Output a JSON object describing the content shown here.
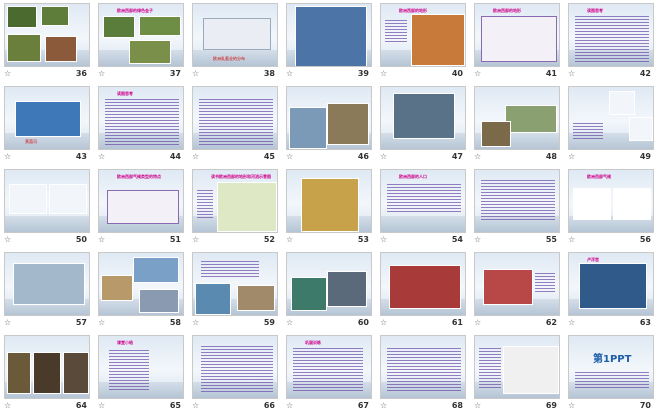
{
  "star_symbol": "☆",
  "slides": [
    {
      "num": "36",
      "title": "",
      "variant": "photos4"
    },
    {
      "num": "37",
      "title": "欧洲西部的绿色金子",
      "variant": "photos3"
    },
    {
      "num": "38",
      "title": "",
      "variant": "diagram",
      "caption": "欧洲乳畜业的分布"
    },
    {
      "num": "39",
      "title": "",
      "variant": "map"
    },
    {
      "num": "40",
      "title": "欧洲西部的地形",
      "variant": "map2"
    },
    {
      "num": "41",
      "title": "欧洲西部的地形",
      "variant": "table"
    },
    {
      "num": "42",
      "title": "读图思考",
      "variant": "text"
    },
    {
      "num": "43",
      "title": "",
      "variant": "photo1",
      "caption": "莱茵河"
    },
    {
      "num": "44",
      "title": "读图思考",
      "variant": "text"
    },
    {
      "num": "45",
      "title": "",
      "variant": "text"
    },
    {
      "num": "46",
      "title": "",
      "variant": "photos2"
    },
    {
      "num": "47",
      "title": "",
      "variant": "photo1b"
    },
    {
      "num": "48",
      "title": "",
      "variant": "photos2b"
    },
    {
      "num": "49",
      "title": "",
      "variant": "charts"
    },
    {
      "num": "50",
      "title": "",
      "variant": "charts2"
    },
    {
      "num": "51",
      "title": "欧洲西部气候类型的特点",
      "variant": "table2"
    },
    {
      "num": "52",
      "title": "读书欧洲西部的地形和河流示意图",
      "variant": "map3"
    },
    {
      "num": "53",
      "title": "",
      "variant": "map4"
    },
    {
      "num": "54",
      "title": "欧洲西部的人口",
      "variant": "text2"
    },
    {
      "num": "55",
      "title": "",
      "variant": "text3"
    },
    {
      "num": "56",
      "title": "欧洲西部气候",
      "variant": "bars"
    },
    {
      "num": "57",
      "title": "",
      "variant": "photo2"
    },
    {
      "num": "58",
      "title": "",
      "variant": "photos3b"
    },
    {
      "num": "59",
      "title": "",
      "variant": "photos2c"
    },
    {
      "num": "60",
      "title": "",
      "variant": "photos2d"
    },
    {
      "num": "61",
      "title": "",
      "variant": "photo3"
    },
    {
      "num": "62",
      "title": "",
      "variant": "photo4"
    },
    {
      "num": "63",
      "title": "卢浮宫",
      "variant": "photo5"
    },
    {
      "num": "64",
      "title": "",
      "variant": "photos3c"
    },
    {
      "num": "65",
      "title": "课堂小结",
      "variant": "list"
    },
    {
      "num": "66",
      "title": "",
      "variant": "tree"
    },
    {
      "num": "67",
      "title": "巩固训练",
      "variant": "text4"
    },
    {
      "num": "68",
      "title": "",
      "variant": "text5"
    },
    {
      "num": "69",
      "title": "",
      "variant": "map5"
    },
    {
      "num": "70",
      "title": "第1PPT",
      "variant": "brand"
    }
  ]
}
